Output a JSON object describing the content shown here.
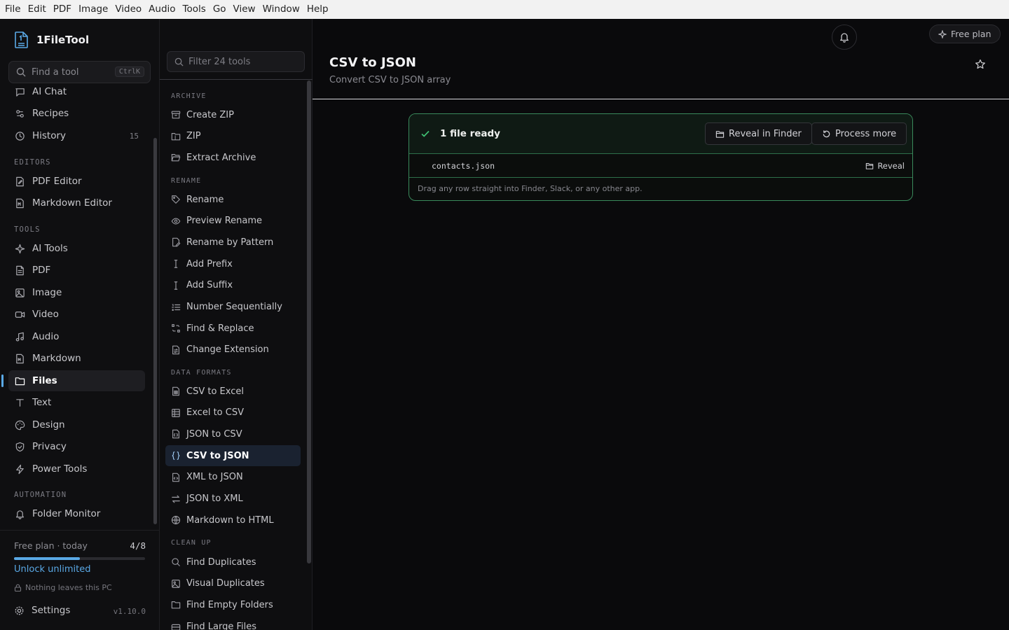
{
  "menubar": [
    "File",
    "Edit",
    "PDF",
    "Image",
    "Video",
    "Audio",
    "Tools",
    "Go",
    "View",
    "Window",
    "Help"
  ],
  "app": {
    "name": "1FileTool",
    "accent": "#5aa9e6",
    "success": "#3a8a5c"
  },
  "sidebar": {
    "search": {
      "placeholder": "Find a tool",
      "shortcut": "CtrlK"
    },
    "top_items": [
      {
        "label": "AI Chat",
        "icon": "chat-icon"
      },
      {
        "label": "Recipes",
        "icon": "recipes-icon"
      },
      {
        "label": "History",
        "icon": "clock-icon",
        "count": "15"
      }
    ],
    "editors_heading": "EDITORS",
    "editors": [
      {
        "label": "PDF Editor",
        "icon": "pdf-edit-icon"
      },
      {
        "label": "Markdown Editor",
        "icon": "markdown-edit-icon"
      }
    ],
    "tools_heading": "TOOLS",
    "tools": [
      {
        "label": "AI Tools",
        "icon": "sparkle-icon"
      },
      {
        "label": "PDF",
        "icon": "file-icon"
      },
      {
        "label": "Image",
        "icon": "image-icon"
      },
      {
        "label": "Video",
        "icon": "video-icon"
      },
      {
        "label": "Audio",
        "icon": "music-icon"
      },
      {
        "label": "Markdown",
        "icon": "markdown-icon"
      },
      {
        "label": "Files",
        "icon": "folder-icon",
        "active": true
      },
      {
        "label": "Text",
        "icon": "text-icon"
      },
      {
        "label": "Design",
        "icon": "palette-icon"
      },
      {
        "label": "Privacy",
        "icon": "shield-icon"
      },
      {
        "label": "Power Tools",
        "icon": "bolt-icon"
      }
    ],
    "automation_heading": "AUTOMATION",
    "automation": [
      {
        "label": "Folder Monitor",
        "icon": "bell-icon"
      }
    ],
    "plan": {
      "label": "Free plan · today",
      "count": "4/8",
      "progress": 0.5,
      "unlock": "Unlock unlimited",
      "privacy": "Nothing leaves this PC"
    },
    "settings": {
      "label": "Settings",
      "version": "v1.10.0"
    }
  },
  "toolpane": {
    "filter_placeholder": "Filter 24 tools",
    "groups": [
      {
        "heading": "ARCHIVE",
        "items": [
          {
            "label": "Create ZIP",
            "icon": "archive-icon"
          },
          {
            "label": "ZIP",
            "icon": "zip-icon"
          },
          {
            "label": "Extract Archive",
            "icon": "folder-open-icon"
          }
        ]
      },
      {
        "heading": "RENAME",
        "items": [
          {
            "label": "Rename",
            "icon": "tag-icon"
          },
          {
            "label": "Preview Rename",
            "icon": "eye-icon"
          },
          {
            "label": "Rename by Pattern",
            "icon": "file-pen-icon"
          },
          {
            "label": "Add Prefix",
            "icon": "text-cursor-icon"
          },
          {
            "label": "Add Suffix",
            "icon": "text-cursor-icon"
          },
          {
            "label": "Number Sequentially",
            "icon": "list-ordered-icon"
          },
          {
            "label": "Find & Replace",
            "icon": "replace-icon"
          },
          {
            "label": "Change Extension",
            "icon": "file-swap-icon"
          }
        ]
      },
      {
        "heading": "DATA FORMATS",
        "items": [
          {
            "label": "CSV to Excel",
            "icon": "file-sheet-icon"
          },
          {
            "label": "Excel to CSV",
            "icon": "table-icon"
          },
          {
            "label": "JSON to CSV",
            "icon": "file-json-icon"
          },
          {
            "label": "CSV to JSON",
            "icon": "braces-icon",
            "active": true
          },
          {
            "label": "XML to JSON",
            "icon": "file-code-icon"
          },
          {
            "label": "JSON to XML",
            "icon": "arrows-swap-icon"
          },
          {
            "label": "Markdown to HTML",
            "icon": "globe-icon"
          }
        ]
      },
      {
        "heading": "CLEAN UP",
        "items": [
          {
            "label": "Find Duplicates",
            "icon": "search-icon"
          },
          {
            "label": "Visual Duplicates",
            "icon": "images-icon"
          },
          {
            "label": "Find Empty Folders",
            "icon": "folder-icon"
          },
          {
            "label": "Find Large Files",
            "icon": "drive-icon"
          }
        ]
      }
    ]
  },
  "main": {
    "free_plan": "Free plan",
    "title": "CSV to JSON",
    "subtitle": "Convert CSV to JSON array",
    "result": {
      "status": "1 file ready",
      "reveal_button": "Reveal in Finder",
      "process_button": "Process more",
      "file_name": "contacts.json",
      "file_reveal": "Reveal",
      "hint": "Drag any row straight into Finder, Slack, or any other app."
    }
  }
}
